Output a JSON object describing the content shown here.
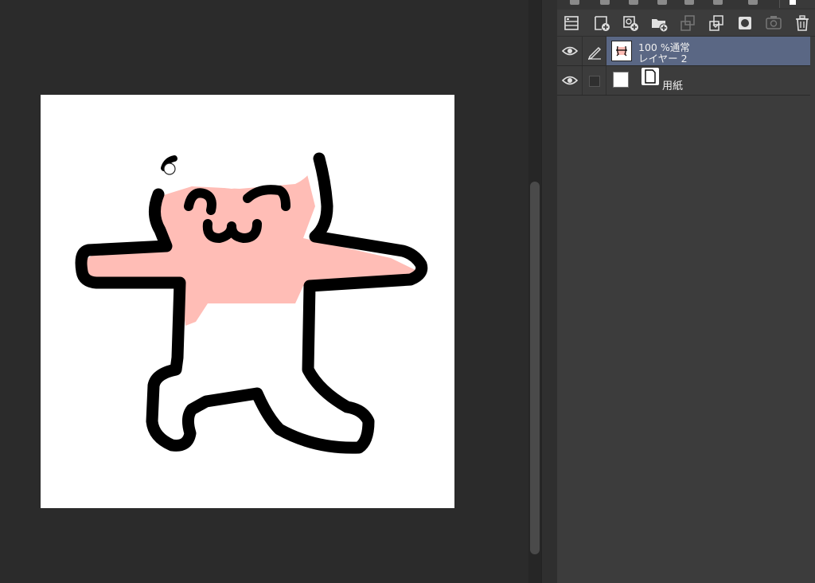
{
  "canvas": {
    "background_color": "#ffffff",
    "stroke_color": "#000000",
    "fill_color": "#ffbdb6",
    "brush_cursor": "circle-brush-cursor"
  },
  "layer_panel": {
    "toolbar_icons": [
      "layer-property-icon",
      "new-raster-layer-icon",
      "new-vector-layer-icon",
      "new-folder-icon",
      "transfer-down-icon",
      "merge-down-icon",
      "layer-mask-icon",
      "mask-apply-icon",
      "delete-layer-icon"
    ],
    "layers": [
      {
        "blend": "100 %通常",
        "name": "レイヤー 2",
        "visible": true,
        "editing": true,
        "selected": true
      },
      {
        "name": "用紙",
        "visible": true,
        "editing": false,
        "selected": false
      }
    ],
    "selected_color": "#5a6784"
  }
}
